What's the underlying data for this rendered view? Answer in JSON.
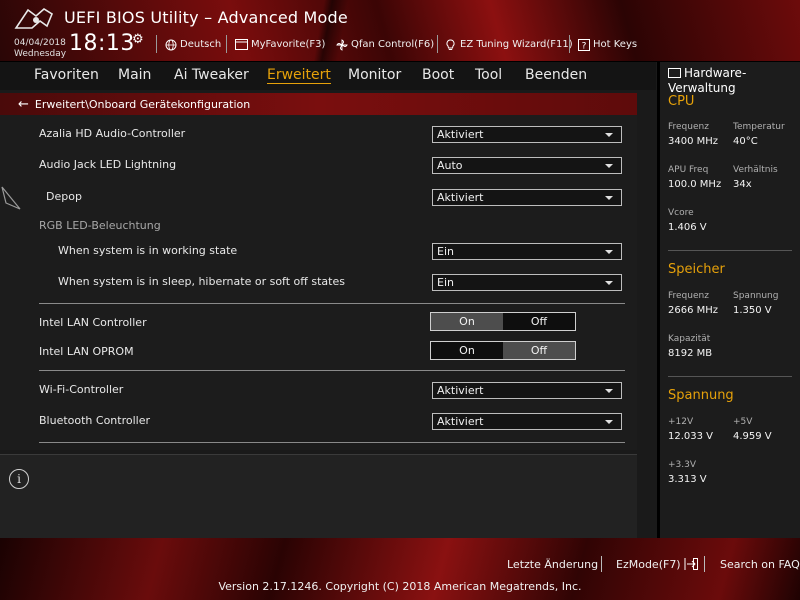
{
  "header": {
    "title": "UEFI BIOS Utility – Advanced Mode",
    "date": "04/04/2018",
    "weekday": "Wednesday",
    "time": "18:13",
    "buttons": {
      "language": "Deutsch",
      "favorite": "MyFavorite(F3)",
      "qfan": "Qfan Control(F6)",
      "ez_tuning": "EZ Tuning Wizard(F11)",
      "hot_keys": "Hot Keys"
    }
  },
  "nav": {
    "tabs": [
      "Favoriten",
      "Main",
      "Ai Tweaker",
      "Erweitert",
      "Monitor",
      "Boot",
      "Tool",
      "Beenden"
    ],
    "active": "Erweitert"
  },
  "breadcrumb": "Erweitert\\Onboard Gerätekonfiguration",
  "settings": {
    "azalia_label": "Azalia HD Audio-Controller",
    "azalia_value": "Aktiviert",
    "audio_led_label": "Audio Jack LED Lightning",
    "audio_led_value": "Auto",
    "depop_label": "Depop",
    "depop_value": "Aktiviert",
    "rgb_header": "RGB LED-Beleuchtung",
    "working_label": "When system is in working state",
    "working_value": "Ein",
    "sleep_label": "When system is in sleep, hibernate or soft off states",
    "sleep_value": "Ein",
    "lan_label": "Intel LAN Controller",
    "lan_on": "On",
    "lan_off": "Off",
    "lan_selected": "On",
    "oprom_label": "Intel LAN OPROM",
    "oprom_on": "On",
    "oprom_off": "Off",
    "oprom_selected": "Off",
    "wifi_label": "Wi-Fi-Controller",
    "wifi_value": "Aktiviert",
    "bt_label": "Bluetooth Controller",
    "bt_value": "Aktiviert"
  },
  "hw": {
    "title": "Hardware-Verwaltung",
    "cpu": {
      "heading": "CPU",
      "freq_label": "Frequenz",
      "freq_value": "3400 MHz",
      "temp_label": "Temperatur",
      "temp_value": "40°C",
      "apu_label": "APU Freq",
      "apu_value": "100.0 MHz",
      "ratio_label": "Verhältnis",
      "ratio_value": "34x",
      "vcore_label": "Vcore",
      "vcore_value": "1.406 V"
    },
    "memory": {
      "heading": "Speicher",
      "freq_label": "Frequenz",
      "freq_value": "2666 MHz",
      "volt_label": "Spannung",
      "volt_value": "1.350 V",
      "cap_label": "Kapazität",
      "cap_value": "8192 MB"
    },
    "voltage": {
      "heading": "Spannung",
      "v12_label": "+12V",
      "v12_value": "12.033 V",
      "v5_label": "+5V",
      "v5_value": "4.959 V",
      "v33_label": "+3.3V",
      "v33_value": "3.313 V"
    }
  },
  "footer": {
    "last_change": "Letzte Änderung",
    "ezmode": "EzMode(F7)",
    "faq": "Search on FAQ",
    "copyright": "Version 2.17.1246. Copyright (C) 2018 American Megatrends, Inc."
  },
  "colors": {
    "accent": "#e6a10a",
    "brand_red": "#8c1010",
    "background": "#1c1c1c"
  },
  "icons": {
    "logo": "rog-logo-icon",
    "clock_settings": "gear-icon",
    "language": "globe-icon",
    "favorite": "favorite-icon",
    "qfan": "fan-icon",
    "ez_tuning": "lightbulb-icon",
    "hot_keys": "question-icon",
    "back": "arrow-left-icon",
    "info": "info-icon",
    "hw_monitor": "monitor-icon",
    "ezmode": "exit-icon"
  }
}
